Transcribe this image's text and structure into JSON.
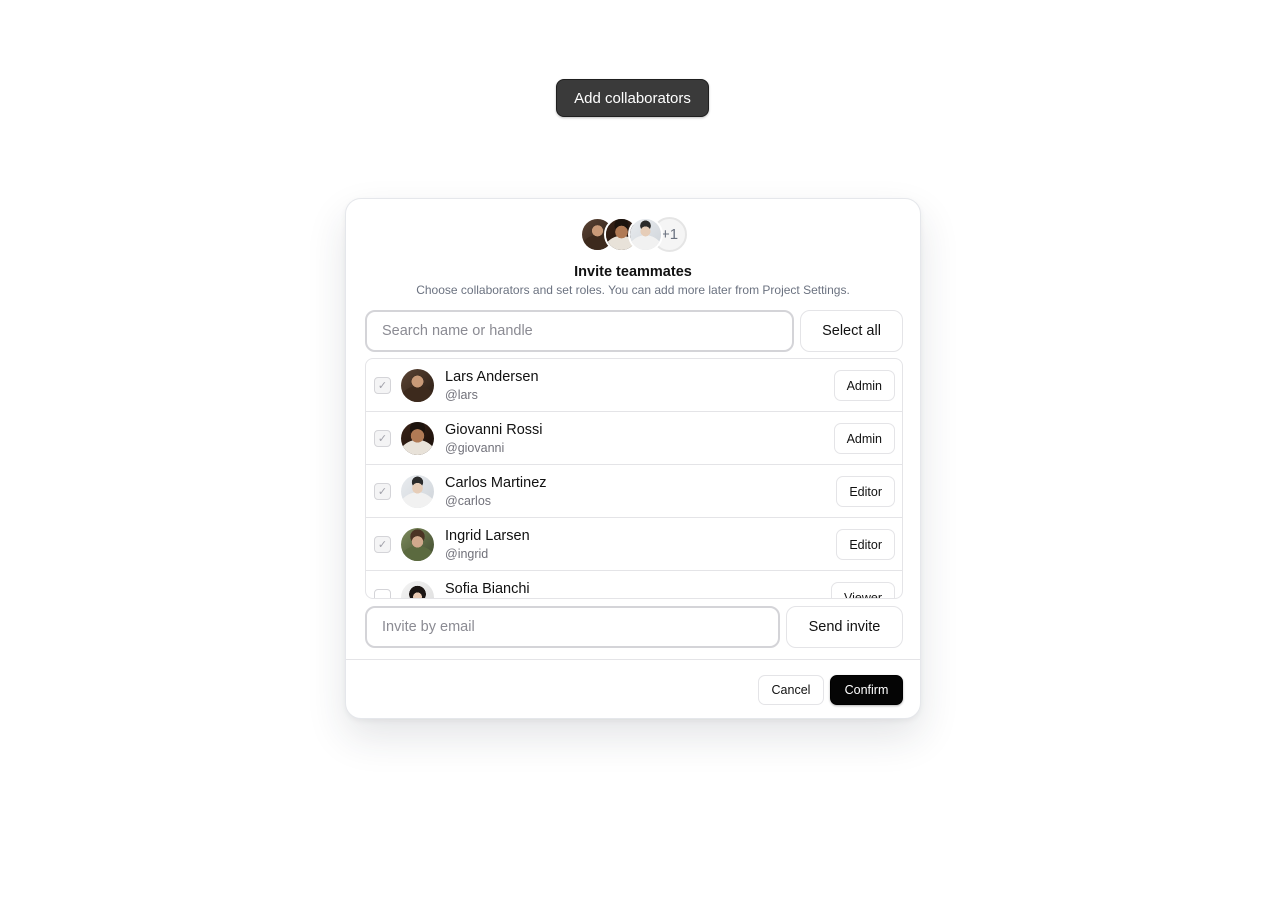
{
  "trigger": {
    "label": "Add collaborators"
  },
  "dialog": {
    "stack_more": "+1",
    "title": "Invite teammates",
    "subtitle": "Choose collaborators and set roles. You can add more later from Project Settings.",
    "search": {
      "placeholder": "Search name or handle",
      "value": ""
    },
    "select_all_label": "Select all",
    "members": [
      {
        "name": "Lars Andersen",
        "handle": "@lars",
        "role": "Admin",
        "checked": true,
        "avatar": "avatar-lars"
      },
      {
        "name": "Giovanni Rossi",
        "handle": "@giovanni",
        "role": "Admin",
        "checked": true,
        "avatar": "avatar-giovanni"
      },
      {
        "name": "Carlos Martinez",
        "handle": "@carlos",
        "role": "Editor",
        "checked": true,
        "avatar": "avatar-carlos"
      },
      {
        "name": "Ingrid Larsen",
        "handle": "@ingrid",
        "role": "Editor",
        "checked": true,
        "avatar": "avatar-ingrid"
      },
      {
        "name": "Sofia Bianchi",
        "handle": "",
        "role": "Viewer",
        "checked": false,
        "avatar": "avatar-sofia"
      }
    ],
    "email": {
      "placeholder": "Invite by email",
      "value": ""
    },
    "send_label": "Send invite",
    "cancel_label": "Cancel",
    "confirm_label": "Confirm"
  },
  "icons": {
    "check": "check-icon"
  },
  "colors": {
    "primary": "#050505",
    "trigger_bg": "#3a3a3a",
    "muted_text": "#6b7280",
    "border": "#e4e4e7"
  }
}
